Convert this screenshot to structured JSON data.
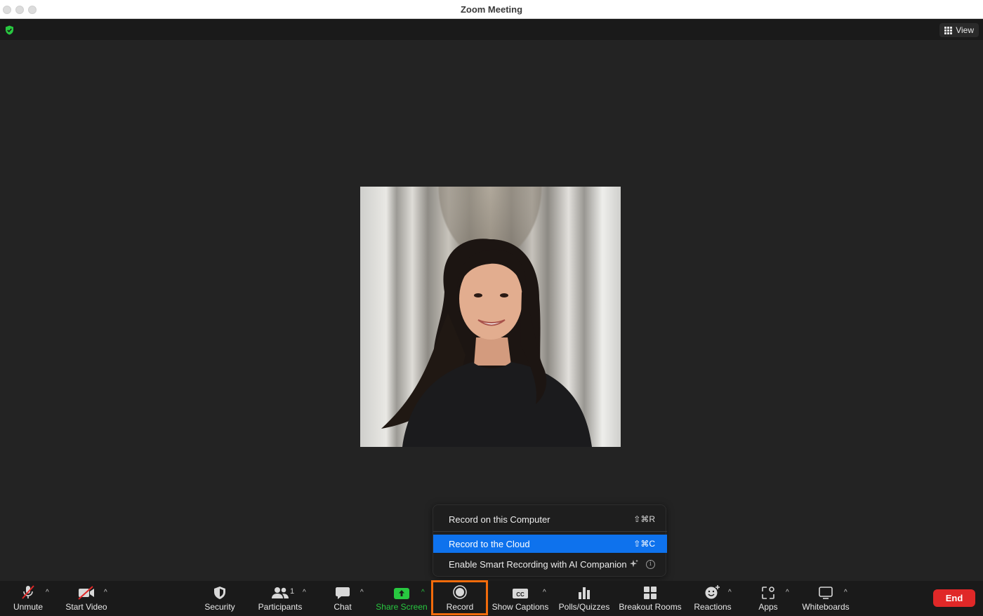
{
  "window": {
    "title": "Zoom Meeting"
  },
  "topbar": {
    "view_label": "View"
  },
  "record_menu": {
    "items": [
      {
        "label": "Record on this Computer",
        "shortcut": "⇧⌘R"
      },
      {
        "label": "Record to the Cloud",
        "shortcut": "⇧⌘C",
        "highlighted": true
      },
      {
        "label": "Enable Smart Recording with AI Companion"
      }
    ]
  },
  "toolbar": {
    "unmute": "Unmute",
    "start_video": "Start Video",
    "security": "Security",
    "participants": "Participants",
    "participant_count": "1",
    "chat": "Chat",
    "share_screen": "Share Screen",
    "record": "Record",
    "show_captions": "Show Captions",
    "polls": "Polls/Quizzes",
    "breakout": "Breakout Rooms",
    "reactions": "Reactions",
    "apps": "Apps",
    "whiteboards": "Whiteboards",
    "end": "End"
  },
  "colors": {
    "accent_blue": "#0e72ed",
    "share_green": "#28c840",
    "end_red": "#e02828",
    "record_highlight": "#f26b0b"
  }
}
